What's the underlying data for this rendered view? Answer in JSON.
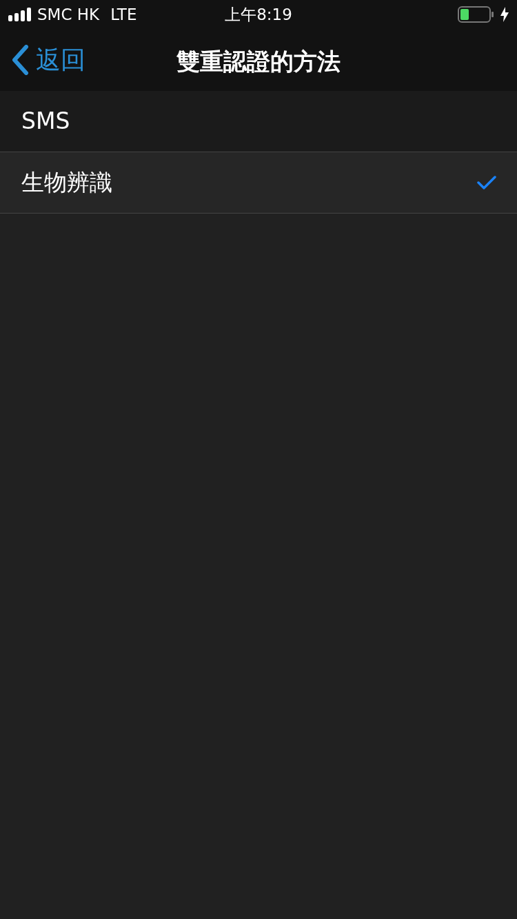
{
  "status_bar": {
    "carrier": "SMC HK",
    "network": "LTE",
    "time": "上午8:19",
    "charging": true
  },
  "nav_bar": {
    "back_label": "返回",
    "title": "雙重認證的方法"
  },
  "options": [
    {
      "label": "SMS",
      "selected": false
    },
    {
      "label": "生物辨識",
      "selected": true
    }
  ]
}
